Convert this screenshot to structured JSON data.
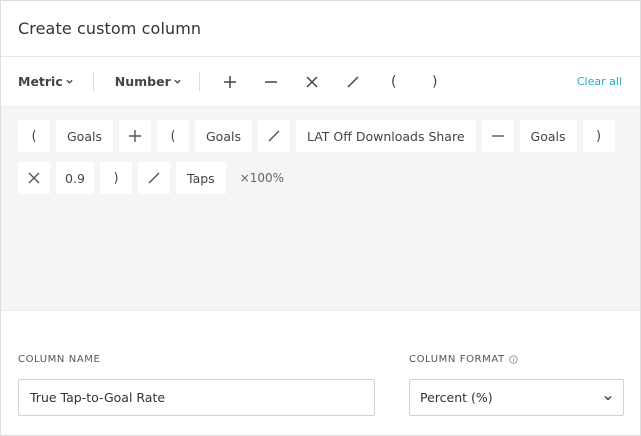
{
  "header": {
    "title": "Create custom column"
  },
  "toolbar": {
    "metric_label": "Metric",
    "number_label": "Number",
    "operators": [
      "plus",
      "minus",
      "multiply",
      "divide",
      "open-paren",
      "close-paren"
    ],
    "open_paren": "(",
    "close_paren": ")",
    "clear_all": "Clear all"
  },
  "formula": {
    "row1": [
      "(",
      "Goals",
      "+",
      "(",
      "Goals",
      "/",
      "LAT Off Downloads Share",
      "−",
      "Goals",
      ")"
    ],
    "row2": [
      "×",
      "0.9",
      ")",
      "/",
      "Taps"
    ],
    "multiplier": "×100%"
  },
  "column_name": {
    "label": "COLUMN NAME",
    "value": "True Tap-to-Goal Rate"
  },
  "column_format": {
    "label": "COLUMN FORMAT",
    "selected": "Percent (%)"
  },
  "colors": {
    "accent": "#25a8c9",
    "formula_bg": "#f4f5f6",
    "border": "#cfd3d7"
  }
}
